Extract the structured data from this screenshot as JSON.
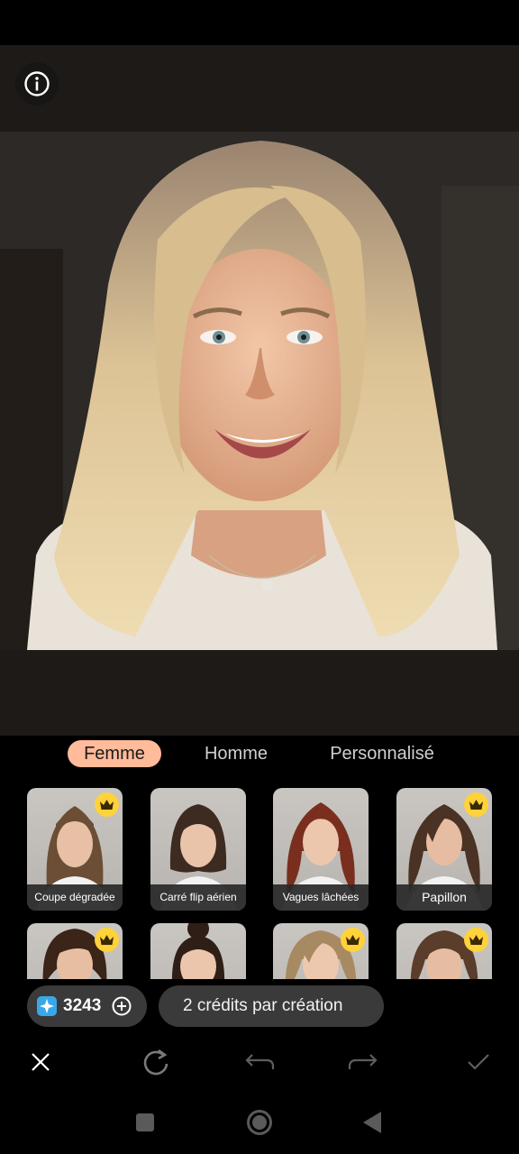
{
  "tabs": [
    {
      "label": "Femme",
      "active": true
    },
    {
      "label": "Homme",
      "active": false
    },
    {
      "label": "Personnalisé",
      "active": false
    }
  ],
  "styles_row1": [
    {
      "label": "Coupe dégradée",
      "premium": true,
      "hair": "#6b4e35"
    },
    {
      "label": "Carré flip aérien",
      "premium": false,
      "hair": "#3d2a20"
    },
    {
      "label": "Vagues lâchées",
      "premium": false,
      "hair": "#7a2e1e"
    },
    {
      "label": "Papillon",
      "premium": true,
      "hair": "#4a3224"
    }
  ],
  "styles_row2": [
    {
      "premium": true,
      "hair": "#3b2418"
    },
    {
      "premium": false,
      "hair": "#2e1e16"
    },
    {
      "premium": true,
      "hair": "#a78a62"
    },
    {
      "premium": true,
      "hair": "#5a3d2a"
    }
  ],
  "credits": {
    "count": "3243",
    "note": "2 crédits par création"
  },
  "icons": {
    "info": "info-icon",
    "credit": "gem-icon",
    "add": "plus-circle-icon",
    "close": "close-icon",
    "regenerate": "refresh-icon",
    "undo": "undo-icon",
    "redo": "redo-icon",
    "confirm": "check-icon",
    "premium": "crown-icon"
  },
  "colors": {
    "accent": "#ffbb9a",
    "premium": "#ffd23a",
    "credit_gem": "#3aa8e8"
  }
}
